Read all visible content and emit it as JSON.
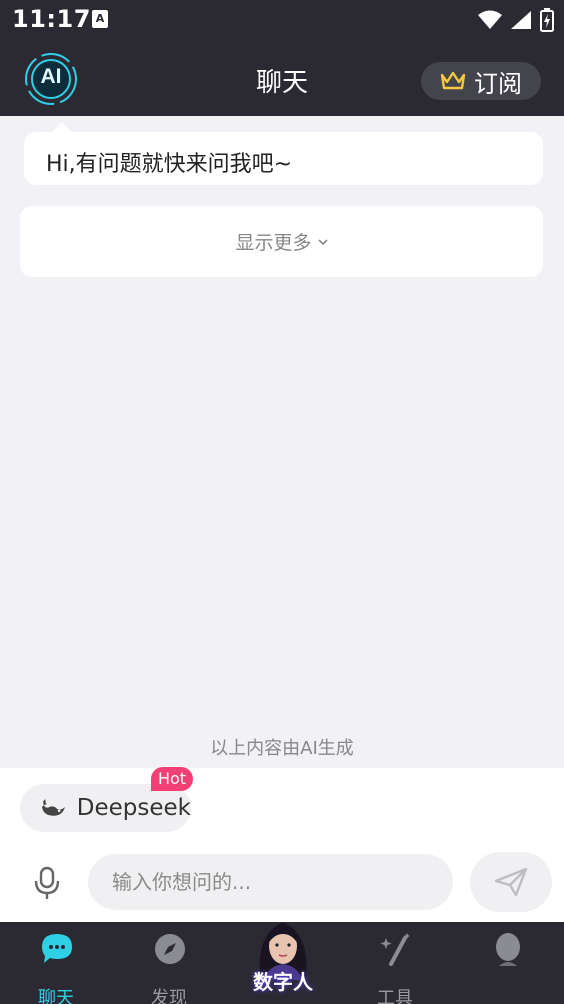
{
  "status_bar": {
    "time": "11:17",
    "notification_glyph": "A"
  },
  "header": {
    "logo_text": "AI",
    "title": "聊天",
    "subscribe_label": "订阅"
  },
  "chat": {
    "greeting": "Hi,有问题就快来问我吧~",
    "show_more_label": "显示更多",
    "ai_disclaimer": "以上内容由AI生成"
  },
  "input_panel": {
    "model_chip_label": "Deepseek",
    "hot_badge": "Hot",
    "placeholder": "输入你想问的..."
  },
  "bottom_nav": {
    "items": [
      {
        "label": "聊天",
        "icon": "chat-bubble-icon",
        "active": true
      },
      {
        "label": "发现",
        "icon": "compass-icon",
        "active": false
      },
      {
        "label": "数字人",
        "icon": "digital-human-avatar",
        "active": false
      },
      {
        "label": "工具",
        "icon": "magic-wand-icon",
        "active": false
      },
      {
        "label": "",
        "icon": "profile-icon",
        "active": false
      }
    ]
  },
  "colors": {
    "accent": "#2fd0e6",
    "dark_bar": "#2b2a33",
    "hot": "#f23f74",
    "background": "#f1f1f6"
  }
}
